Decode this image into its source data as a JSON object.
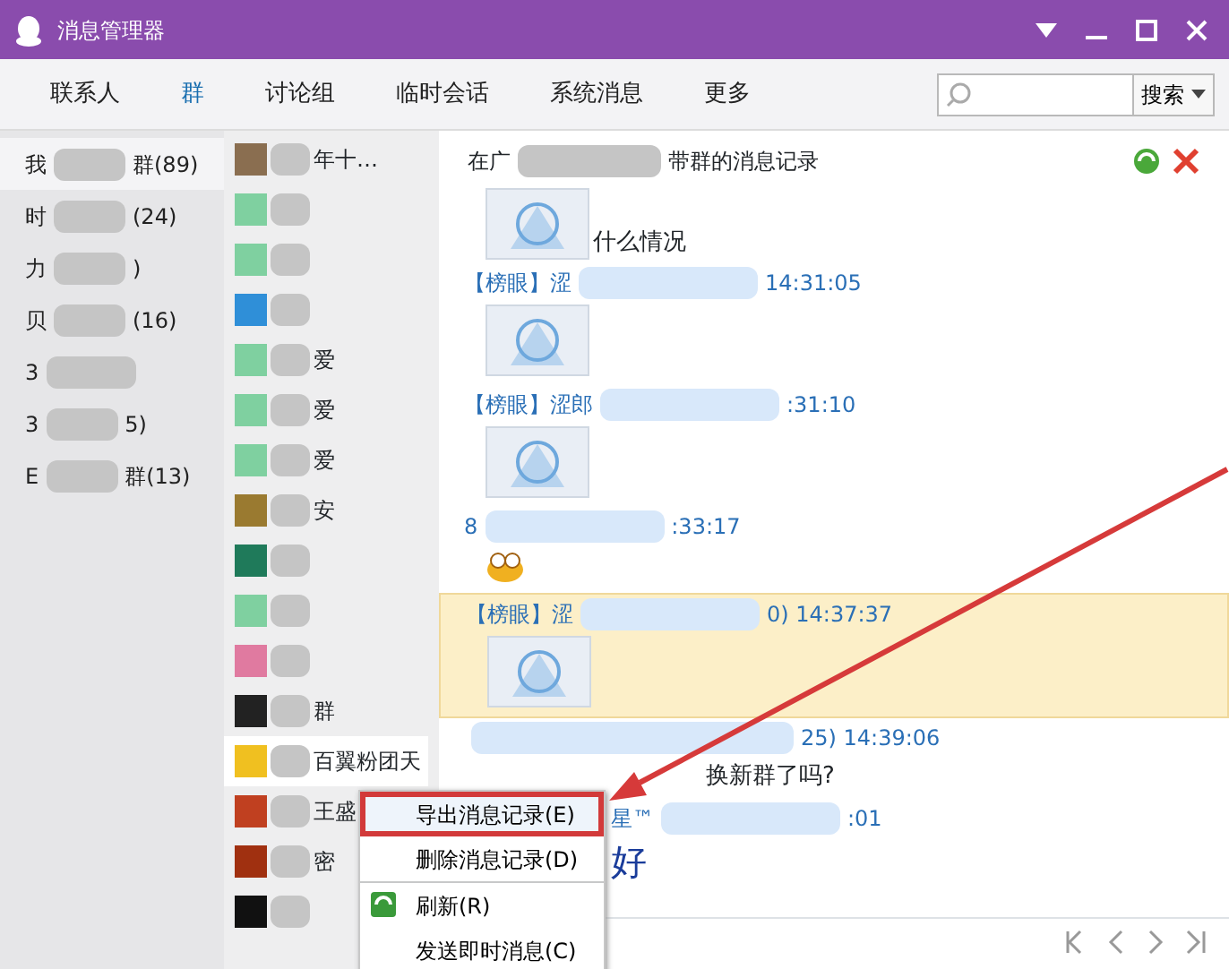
{
  "window": {
    "title": "消息管理器"
  },
  "tabs": [
    {
      "label": "联系人",
      "selected": false
    },
    {
      "label": "群",
      "selected": true
    },
    {
      "label": "讨论组",
      "selected": false
    },
    {
      "label": "临时会话",
      "selected": false
    },
    {
      "label": "系统消息",
      "selected": false
    },
    {
      "label": "更多",
      "selected": false
    }
  ],
  "search": {
    "button": "搜索"
  },
  "categories": [
    {
      "head": "我",
      "tail": "群(89)",
      "selected": true
    },
    {
      "head": "时",
      "tail": "(24)",
      "selected": false
    },
    {
      "head": "力",
      "tail": ")",
      "selected": false
    },
    {
      "head": "贝",
      "tail": "(16)",
      "selected": false
    },
    {
      "head": "3",
      "selected": false
    },
    {
      "head": "3",
      "tail": "5)",
      "selected": false
    },
    {
      "head": "E",
      "tail": "群(13)",
      "selected": false
    }
  ],
  "groups": [
    {
      "text": "年十…",
      "color": "#8a6e50",
      "selected": false
    },
    {
      "color": "#7fd0a0",
      "selected": false
    },
    {
      "color": "#7fd0a0",
      "selected": false
    },
    {
      "color": "#2f8fd8",
      "selected": false
    },
    {
      "text": "爱",
      "color": "#7fd0a0",
      "selected": false
    },
    {
      "text": "爱",
      "color": "#7fd0a0",
      "selected": false
    },
    {
      "text": "爱",
      "color": "#7fd0a0",
      "selected": false
    },
    {
      "text": "安",
      "color": "#9a7a30",
      "selected": false
    },
    {
      "color": "#1f7a5a",
      "selected": false
    },
    {
      "color": "#7fd0a0",
      "selected": false
    },
    {
      "color": "#e07aa0",
      "selected": false
    },
    {
      "text": "群",
      "color": "#222222",
      "selected": false
    },
    {
      "text": "百翼粉团天",
      "color": "#f0c020",
      "selected": true
    },
    {
      "text": "王盛",
      "color": "#c04020",
      "selected": false
    },
    {
      "text": "密",
      "color": "#a03010",
      "selected": false
    },
    {
      "color": "#111111",
      "selected": false
    }
  ],
  "history": {
    "title_head": "在广",
    "title_tail": "带群的消息记录",
    "messages": [
      {
        "kind": "image-text",
        "text": "什么情况",
        "highlighted": false
      },
      {
        "kind": "image",
        "sender": "【榜眼】涩",
        "time": "14:31:05",
        "highlighted": false
      },
      {
        "kind": "image",
        "sender": "【榜眼】涩郎",
        "time": ":31:10",
        "highlighted": false
      },
      {
        "kind": "emoji",
        "sender": "8",
        "time": ":33:17",
        "highlighted": false
      },
      {
        "kind": "image",
        "sender": "【榜眼】涩",
        "time": "0) 14:37:37",
        "highlighted": true
      },
      {
        "kind": "text",
        "time": "25) 14:39:06",
        "text": "换新群了吗?",
        "highlighted": false
      },
      {
        "kind": "big",
        "sender": "星™",
        "time": ":01",
        "text": "好",
        "highlighted": false
      }
    ]
  },
  "context_menu": [
    {
      "label": "导出消息记录(E)",
      "selected": true,
      "icon": false
    },
    {
      "label": "删除消息记录(D)",
      "selected": false,
      "icon": false
    },
    {
      "label": "刷新(R)",
      "selected": false,
      "icon": true
    },
    {
      "label": "发送即时消息(C)",
      "selected": false,
      "icon": false
    }
  ]
}
